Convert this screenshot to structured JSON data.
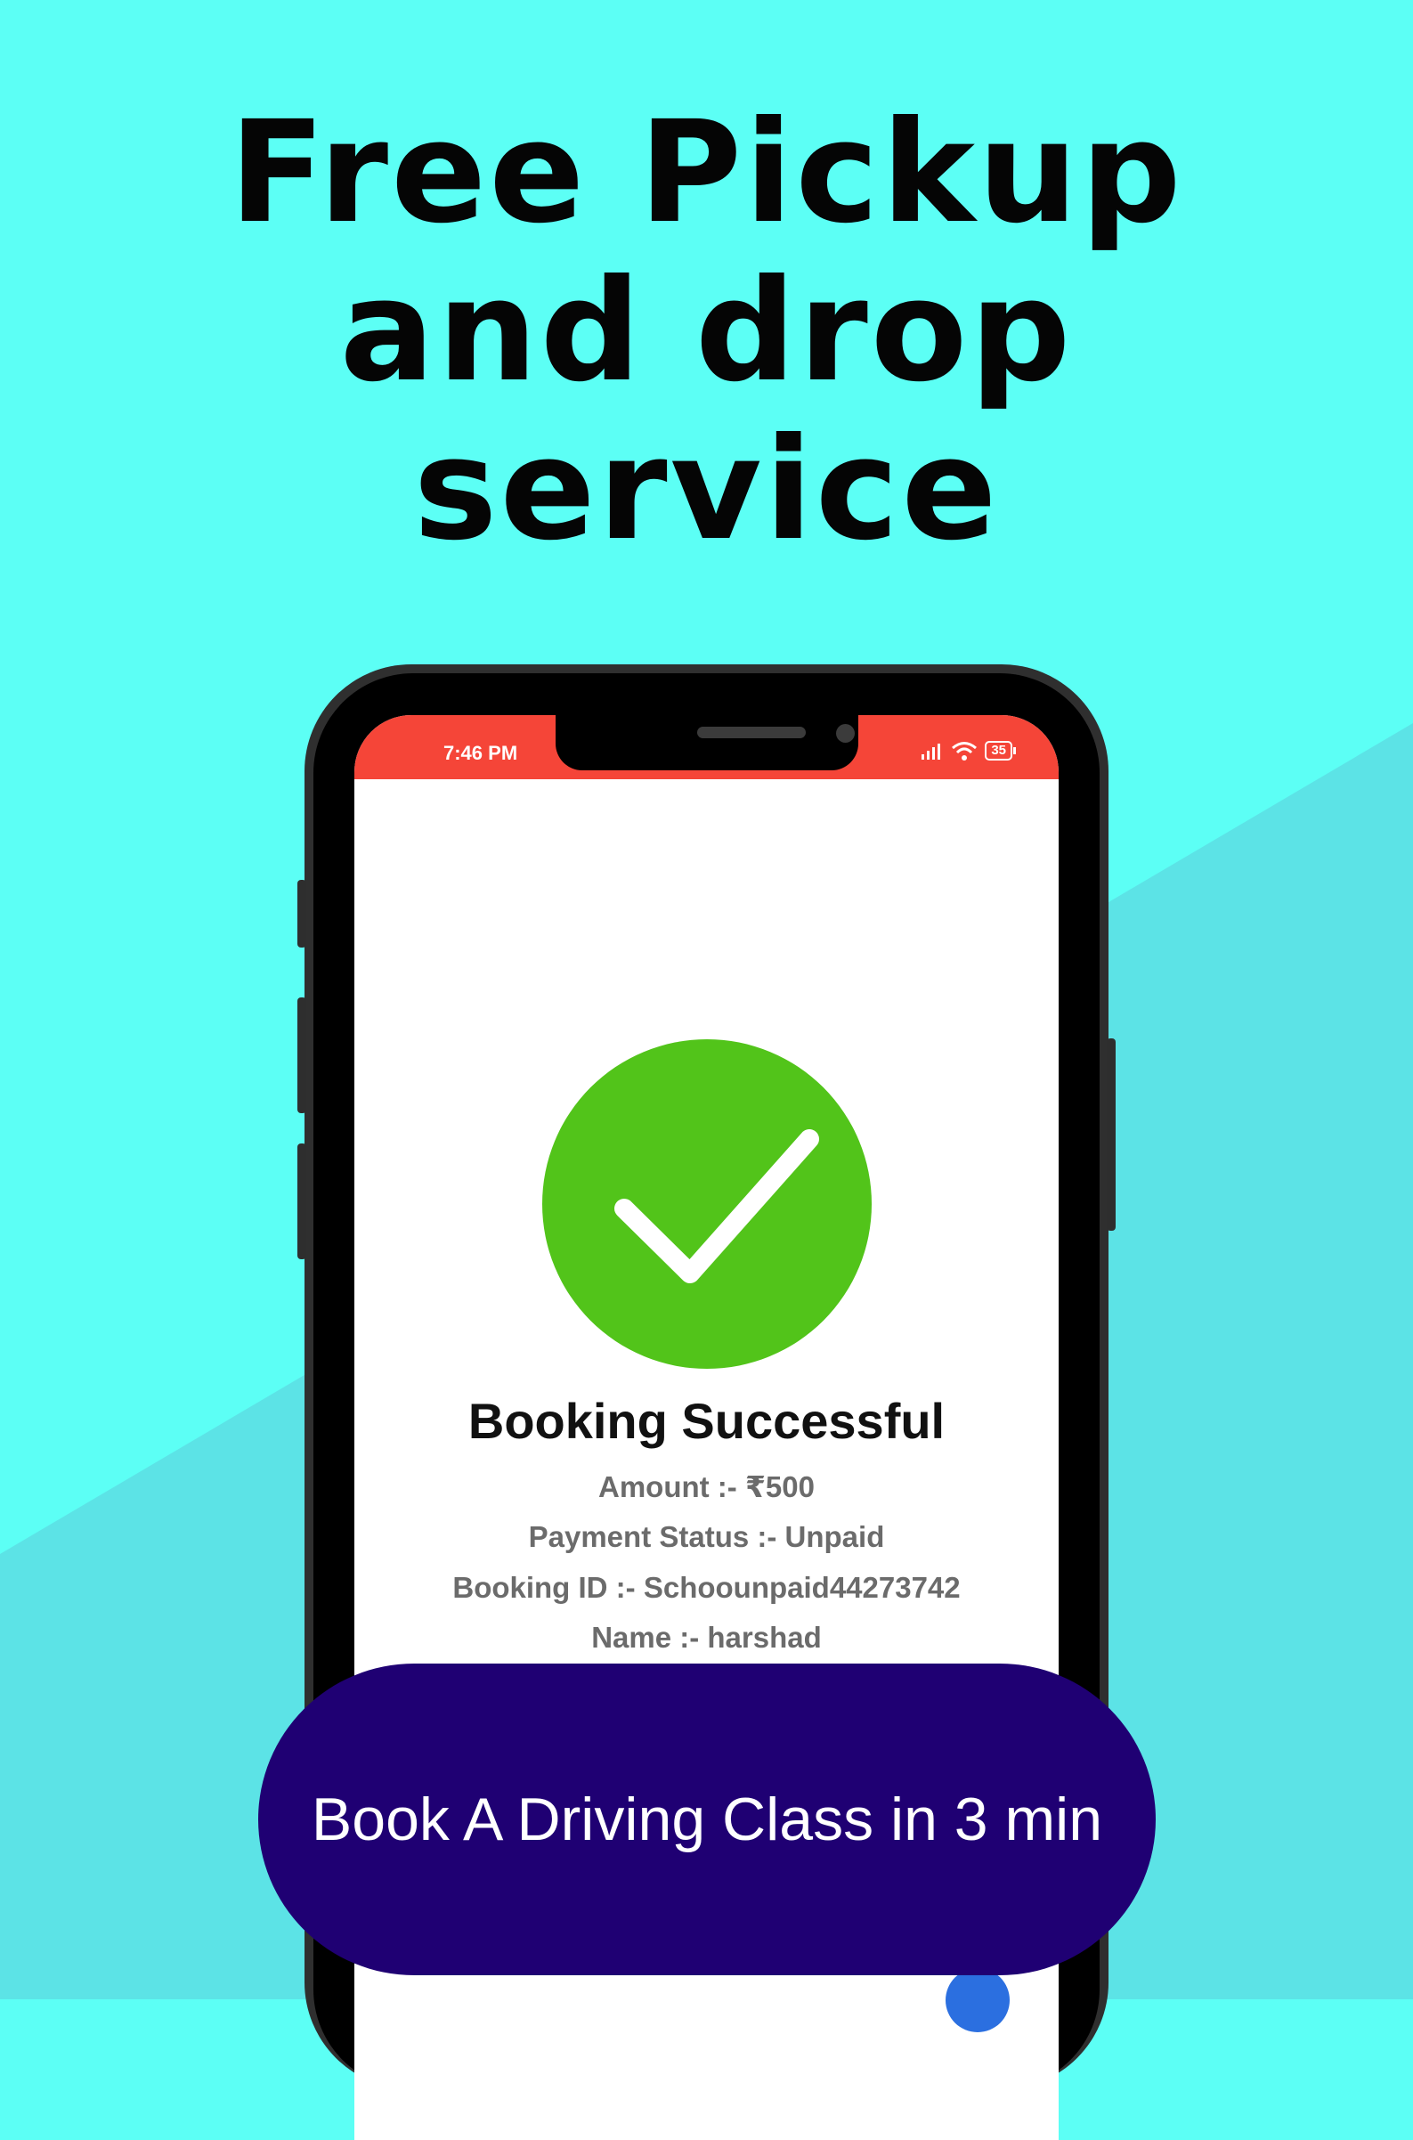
{
  "colors": {
    "background": "#5cfff5",
    "background_shade": "#5ce3e6",
    "status_bar": "#f54538",
    "success": "#52c41a",
    "cta": "#1f0073"
  },
  "headline": {
    "line1": "Free Pickup",
    "line2": "and drop",
    "line3": "service"
  },
  "status_bar": {
    "time": "7:46 PM",
    "battery": "35"
  },
  "booking": {
    "title": "Booking Successful",
    "amount": "Amount :-  ₹500",
    "payment_status": "Payment Status :-  Unpaid",
    "booking_id": "Booking ID :-  Schoounpaid44273742",
    "name": "Name :-  harshad"
  },
  "cta": {
    "label": "Book A Driving Class in 3 min"
  },
  "icons": [
    "check-icon",
    "wifi-icon",
    "signal-icon",
    "battery-icon"
  ]
}
